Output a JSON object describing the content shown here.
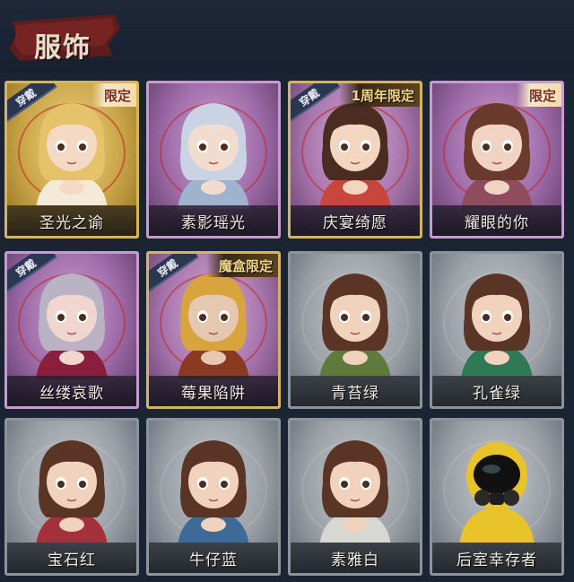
{
  "header": {
    "title": "服饰"
  },
  "costumes": [
    {
      "name": "圣光之谕",
      "rarity": "gold",
      "equipped_label": "穿戴",
      "badge": "限定",
      "badge_style": "light",
      "hair": "#e6c36a",
      "outfit": "#f3ead8",
      "skin": "#f4d9c4"
    },
    {
      "name": "素影瑶光",
      "rarity": "purple",
      "equipped_label": "",
      "badge": "",
      "badge_style": "",
      "hair": "#c9d3e4",
      "outfit": "#9fb3cf",
      "skin": "#f2dccd"
    },
    {
      "name": "庆宴绮愿",
      "rarity": "purple-gold",
      "equipped_label": "穿戴",
      "badge": "1周年限定",
      "badge_style": "dark",
      "hair": "#4a2c20",
      "outfit": "#c9463d",
      "skin": "#f2d6bf"
    },
    {
      "name": "耀眼的你",
      "rarity": "purple",
      "equipped_label": "",
      "badge": "限定",
      "badge_style": "light",
      "hair": "#6a3a2c",
      "outfit": "#8e4c5e",
      "skin": "#f0d3c3"
    },
    {
      "name": "丝缕哀歌",
      "rarity": "purple",
      "equipped_label": "穿戴",
      "badge": "",
      "badge_style": "",
      "hair": "#b9b3c4",
      "outfit": "#8a1e3c",
      "skin": "#efd7cf"
    },
    {
      "name": "莓果陷阱",
      "rarity": "purple-gold",
      "equipped_label": "穿戴",
      "badge": "魔盒限定",
      "badge_style": "dark",
      "hair": "#d7a43e",
      "outfit": "#8a3a22",
      "skin": "#e6c7b0"
    },
    {
      "name": "青苔绿",
      "rarity": "grey",
      "equipped_label": "",
      "badge": "",
      "badge_style": "",
      "hair": "#5a3424",
      "outfit": "#5e7a3c",
      "skin": "#f1d3bd"
    },
    {
      "name": "孔雀绿",
      "rarity": "grey",
      "equipped_label": "",
      "badge": "",
      "badge_style": "",
      "hair": "#5a3424",
      "outfit": "#2f7a55",
      "skin": "#f1d3bd"
    },
    {
      "name": "宝石红",
      "rarity": "grey",
      "equipped_label": "",
      "badge": "",
      "badge_style": "",
      "hair": "#5a3424",
      "outfit": "#a3303a",
      "skin": "#f1d3bd"
    },
    {
      "name": "牛仔蓝",
      "rarity": "grey",
      "equipped_label": "",
      "badge": "",
      "badge_style": "",
      "hair": "#5a3424",
      "outfit": "#3e6a9a",
      "skin": "#f1d3bd"
    },
    {
      "name": "素雅白",
      "rarity": "grey",
      "equipped_label": "",
      "badge": "",
      "badge_style": "",
      "hair": "#5a3424",
      "outfit": "#d8d8d2",
      "skin": "#f1d3bd"
    },
    {
      "name": "后室幸存者",
      "rarity": "grey",
      "equipped_label": "",
      "badge": "",
      "badge_style": "",
      "hair": "#111111",
      "outfit": "#e8c42a",
      "skin": "#1a1a1a"
    }
  ]
}
